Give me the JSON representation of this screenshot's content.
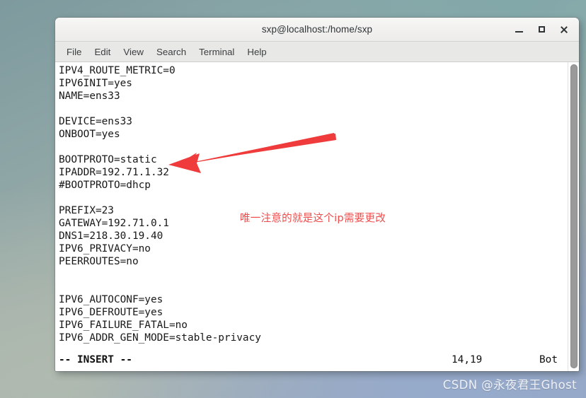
{
  "window": {
    "title": "sxp@localhost:/home/sxp",
    "controls": {
      "minimize": "minimize",
      "maximize": "maximize",
      "close": "close"
    }
  },
  "menubar": {
    "items": [
      {
        "label": "File"
      },
      {
        "label": "Edit"
      },
      {
        "label": "View"
      },
      {
        "label": "Search"
      },
      {
        "label": "Terminal"
      },
      {
        "label": "Help"
      }
    ]
  },
  "terminal": {
    "content": "IPV4_ROUTE_METRIC=0\nIPV6INIT=yes\nNAME=ens33\n\nDEVICE=ens33\nONBOOT=yes\n\nBOOTPROTO=static\nIPADDR=192.71.1.32\n#BOOTPROTO=dhcp\n\nPREFIX=23\nGATEWAY=192.71.0.1\nDNS1=218.30.19.40\nIPV6_PRIVACY=no\nPEERROUTES=no\n\n\nIPV6_AUTOCONF=yes\nIPV6_DEFROUTE=yes\nIPV6_FAILURE_FATAL=no\nIPV6_ADDR_GEN_MODE=stable-privacy",
    "lines": [
      "IPV4_ROUTE_METRIC=0",
      "IPV6INIT=yes",
      "NAME=ens33",
      "",
      "DEVICE=ens33",
      "ONBOOT=yes",
      "",
      "BOOTPROTO=static",
      "IPADDR=192.71.1.32",
      "#BOOTPROTO=dhcp",
      "",
      "PREFIX=23",
      "GATEWAY=192.71.0.1",
      "DNS1=218.30.19.40",
      "IPV6_PRIVACY=no",
      "PEERROUTES=no",
      "",
      "",
      "IPV6_AUTOCONF=yes",
      "IPV6_DEFROUTE=yes",
      "IPV6_FAILURE_FATAL=no",
      "IPV6_ADDR_GEN_MODE=stable-privacy"
    ],
    "status": {
      "mode": "-- INSERT --",
      "position": "14,19",
      "scroll": "Bot"
    }
  },
  "annotations": {
    "arrow": {
      "name": "red-arrow-pointing-to-ipaddr",
      "color": "#ef3b3b"
    },
    "note": {
      "text": "唯一注意的就是这个ip需要更改",
      "color": "#f04b4b"
    }
  },
  "watermark": {
    "text": "CSDN @永夜君王Ghost"
  },
  "colors": {
    "accent_red": "#ef3b3b",
    "terminal_bg": "#ffffff",
    "terminal_fg": "#181818",
    "titlebar_bg": "#f2f1f0",
    "menubar_bg": "#e8e8e6"
  }
}
